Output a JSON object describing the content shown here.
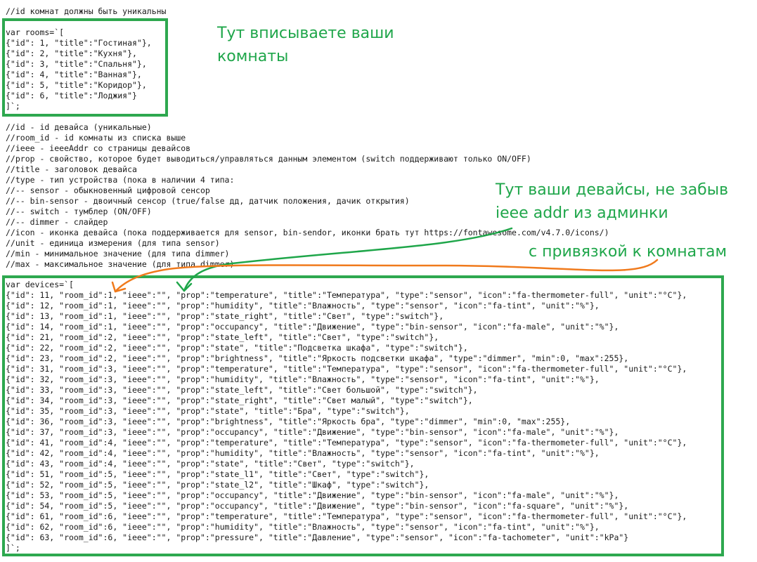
{
  "header_comment": "//id комнат должны быть уникальны",
  "rooms_block": {
    "open": "var rooms=`[",
    "lines": [
      "{\"id\": 1, \"title\":\"Гостиная\"},",
      "{\"id\": 2, \"title\":\"Кухня\"},",
      "{\"id\": 3, \"title\":\"Спальня\"},",
      "{\"id\": 4, \"title\":\"Ванная\"},",
      "{\"id\": 5, \"title\":\"Коридор\"},",
      "{\"id\": 6, \"title\":\"Лоджия\"}"
    ],
    "close": "]`;"
  },
  "doc_comments": [
    "//id - id девайса (уникальные)",
    "//room_id - id комнаты из списка выше",
    "//ieee - ieeeAddr со страницы девайсов",
    "//prop - свойство, которое будет выводиться/управляться данным элементом (switch поддерживают только ON/OFF)",
    "//title - заголовок девайса",
    "//type - тип устройства (пока в наличии 4 типа:",
    "//-- sensor - обыкновенный цифровой сенсор",
    "//-- bin-sensor - двоичный сенсор (true/false дд, датчик положения, дачик открытия)",
    "//-- switch - тумблер (ON/OFF)",
    "//-- dimmer - слайдер",
    "//icon - иконка девайса (пока поддерживается для sensor, bin-sendor, иконки брать тут https://fontawesome.com/v4.7.0/icons/)",
    "//unit - единица измерения (для типа sensor)",
    "//min - минимальное значение (для типа dimmer)",
    "//max - максимальное значение (для типа dimmer)"
  ],
  "devices_block": {
    "open": "var devices=`[",
    "lines": [
      "{\"id\": 11, \"room_id\":1, \"ieee\":\"\", \"prop\":\"temperature\", \"title\":\"Температура\", \"type\":\"sensor\", \"icon\":\"fa-thermometer-full\", \"unit\":\"°C\"},",
      "{\"id\": 12, \"room_id\":1, \"ieee\":\"\", \"prop\":\"humidity\", \"title\":\"Влажность\", \"type\":\"sensor\", \"icon\":\"fa-tint\", \"unit\":\"%\"},",
      "{\"id\": 13, \"room_id\":1, \"ieee\":\"\", \"prop\":\"state_right\", \"title\":\"Свет\", \"type\":\"switch\"},",
      "{\"id\": 14, \"room_id\":1, \"ieee\":\"\", \"prop\":\"occupancy\", \"title\":\"Движение\", \"type\":\"bin-sensor\", \"icon\":\"fa-male\", \"unit\":\"%\"},",
      "{\"id\": 21, \"room_id\":2, \"ieee\":\"\", \"prop\":\"state_left\", \"title\":\"Свет\", \"type\":\"switch\"},",
      "{\"id\": 22, \"room_id\":2, \"ieee\":\"\", \"prop\":\"state\", \"title\":\"Подсветка шкафа\", \"type\":\"switch\"},",
      "{\"id\": 23, \"room_id\":2, \"ieee\":\"\", \"prop\":\"brightness\", \"title\":\"Яркость подсветки шкафа\", \"type\":\"dimmer\", \"min\":0, \"max\":255},",
      "{\"id\": 31, \"room_id\":3, \"ieee\":\"\", \"prop\":\"temperature\", \"title\":\"Температура\", \"type\":\"sensor\", \"icon\":\"fa-thermometer-full\", \"unit\":\"°C\"},",
      "{\"id\": 32, \"room_id\":3, \"ieee\":\"\", \"prop\":\"humidity\", \"title\":\"Влажность\", \"type\":\"sensor\", \"icon\":\"fa-tint\", \"unit\":\"%\"},",
      "{\"id\": 33, \"room_id\":3, \"ieee\":\"\", \"prop\":\"state_left\", \"title\":\"Свет большой\", \"type\":\"switch\"},",
      "{\"id\": 34, \"room_id\":3, \"ieee\":\"\", \"prop\":\"state_right\", \"title\":\"Свет малый\", \"type\":\"switch\"},",
      "{\"id\": 35, \"room_id\":3, \"ieee\":\"\", \"prop\":\"state\", \"title\":\"Бра\", \"type\":\"switch\"},",
      "{\"id\": 36, \"room_id\":3, \"ieee\":\"\", \"prop\":\"brightness\", \"title\":\"Яркость бра\", \"type\":\"dimmer\", \"min\":0, \"max\":255},",
      "{\"id\": 37, \"room_id\":3, \"ieee\":\"\", \"prop\":\"occupancy\", \"title\":\"Движение\", \"type\":\"bin-sensor\", \"icon\":\"fa-male\", \"unit\":\"%\"},",
      "{\"id\": 41, \"room_id\":4, \"ieee\":\"\", \"prop\":\"temperature\", \"title\":\"Температура\", \"type\":\"sensor\", \"icon\":\"fa-thermometer-full\", \"unit\":\"°C\"},",
      "{\"id\": 42, \"room_id\":4, \"ieee\":\"\", \"prop\":\"humidity\", \"title\":\"Влажность\", \"type\":\"sensor\", \"icon\":\"fa-tint\", \"unit\":\"%\"},",
      "{\"id\": 43, \"room_id\":4, \"ieee\":\"\", \"prop\":\"state\", \"title\":\"Свет\", \"type\":\"switch\"},",
      "{\"id\": 51, \"room_id\":5, \"ieee\":\"\", \"prop\":\"state_l1\", \"title\":\"Свет\", \"type\":\"switch\"},",
      "{\"id\": 52, \"room_id\":5, \"ieee\":\"\", \"prop\":\"state_l2\", \"title\":\"Шкаф\", \"type\":\"switch\"},",
      "{\"id\": 53, \"room_id\":5, \"ieee\":\"\", \"prop\":\"occupancy\", \"title\":\"Движение\", \"type\":\"bin-sensor\", \"icon\":\"fa-male\", \"unit\":\"%\"},",
      "{\"id\": 54, \"room_id\":5, \"ieee\":\"\", \"prop\":\"occupancy\", \"title\":\"Движение\", \"type\":\"bin-sensor\", \"icon\":\"fa-square\", \"unit\":\"%\"},",
      "{\"id\": 61, \"room_id\":6, \"ieee\":\"\", \"prop\":\"temperature\", \"title\":\"Температура\", \"type\":\"sensor\", \"icon\":\"fa-thermometer-full\", \"unit\":\"°C\"},",
      "{\"id\": 62, \"room_id\":6, \"ieee\":\"\", \"prop\":\"humidity\", \"title\":\"Влажность\", \"type\":\"sensor\", \"icon\":\"fa-tint\", \"unit\":\"%\"},",
      "{\"id\": 63, \"room_id\":6, \"ieee\":\"\", \"prop\":\"pressure\", \"title\":\"Давление\", \"type\":\"sensor\", \"icon\":\"fa-tachometer\", \"unit\":\"kPa\"}"
    ],
    "close": "]`;"
  },
  "annotations": {
    "rooms_note": "Тут вписываете ваши\nкомнаты",
    "devices_note": "Тут ваши девайсы, не забыв\nieee addr из админки",
    "binding_note": "с привязкой к комнатам"
  },
  "colors": {
    "annotation_green": "#1fa64a",
    "box_green": "#2ea84f",
    "arrow_orange": "#f07a1c"
  }
}
